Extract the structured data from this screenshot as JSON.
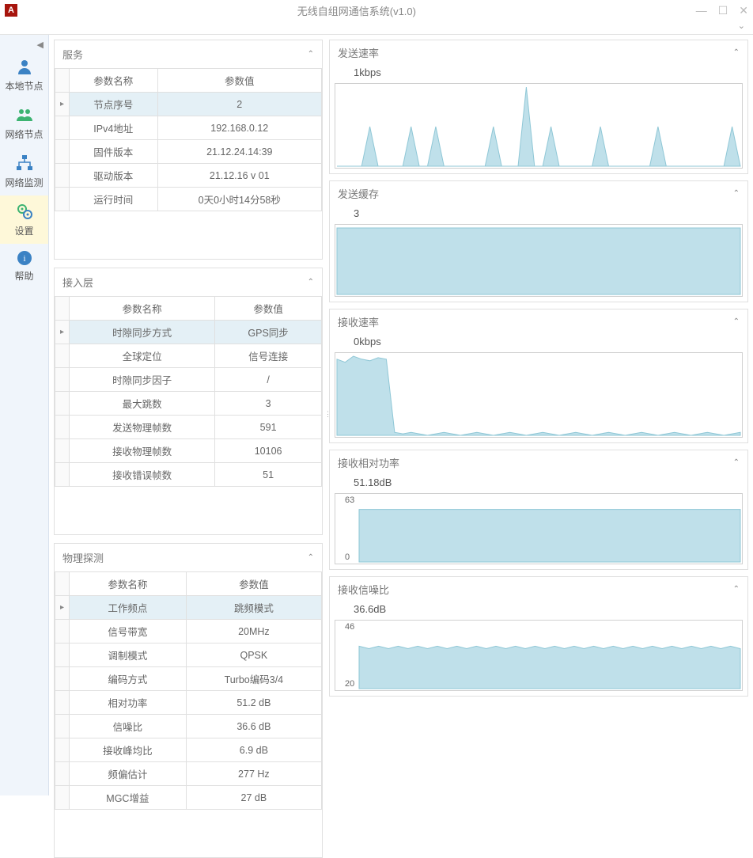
{
  "window": {
    "title": "无线自组网通信系统(v1.0)"
  },
  "sidebar": {
    "items": [
      {
        "label": "本地节点"
      },
      {
        "label": "网络节点"
      },
      {
        "label": "网络监测"
      },
      {
        "label": "设置"
      },
      {
        "label": "帮助"
      }
    ]
  },
  "panels": {
    "service": {
      "title": "服务",
      "headers": {
        "name": "参数名称",
        "value": "参数值"
      },
      "rows": [
        {
          "name": "节点序号",
          "value": "2",
          "hl": true
        },
        {
          "name": "IPv4地址",
          "value": "192.168.0.12"
        },
        {
          "name": "固件版本",
          "value": "21.12.24.14:39"
        },
        {
          "name": "驱动版本",
          "value": "21.12.16 v 01"
        },
        {
          "name": "运行时间",
          "value": "0天0小时14分58秒"
        }
      ]
    },
    "access": {
      "title": "接入层",
      "headers": {
        "name": "参数名称",
        "value": "参数值"
      },
      "rows": [
        {
          "name": "时隙同步方式",
          "value": "GPS同步",
          "hl": true
        },
        {
          "name": "全球定位",
          "value": "信号连接"
        },
        {
          "name": "时隙同步因子",
          "value": "/"
        },
        {
          "name": "最大跳数",
          "value": "3"
        },
        {
          "name": "发送物理帧数",
          "value": "591"
        },
        {
          "name": "接收物理帧数",
          "value": "10106"
        },
        {
          "name": "接收错误帧数",
          "value": "51"
        }
      ]
    },
    "phy": {
      "title": "物理探测",
      "headers": {
        "name": "参数名称",
        "value": "参数值"
      },
      "rows": [
        {
          "name": "工作频点",
          "value": "跳频模式",
          "hl": true
        },
        {
          "name": "信号带宽",
          "value": "20MHz"
        },
        {
          "name": "调制模式",
          "value": "QPSK"
        },
        {
          "name": "编码方式",
          "value": "Turbo编码3/4"
        },
        {
          "name": "相对功率",
          "value": "51.2 dB"
        },
        {
          "name": "信噪比",
          "value": "36.6 dB"
        },
        {
          "name": "接收峰均比",
          "value": "6.9 dB"
        },
        {
          "name": "频偏估计",
          "value": "277 Hz"
        },
        {
          "name": "MGC增益",
          "value": "27 dB"
        }
      ]
    }
  },
  "charts": {
    "tx_rate": {
      "title": "发送速率",
      "reading": "1kbps"
    },
    "tx_buf": {
      "title": "发送缓存",
      "reading": "3"
    },
    "rx_rate": {
      "title": "接收速率",
      "reading": "0kbps"
    },
    "rx_power": {
      "title": "接收相对功率",
      "reading": "51.18dB",
      "ymax": "63",
      "ymin": "0"
    },
    "rx_snr": {
      "title": "接收信噪比",
      "reading": "36.6dB",
      "ymax": "46",
      "ymin": "20"
    }
  },
  "chart_data": [
    {
      "type": "area",
      "title": "发送速率",
      "ylabel": "kbps",
      "values": [
        0,
        0,
        0,
        0,
        1,
        0,
        0,
        0,
        0,
        1,
        0,
        0,
        1,
        0,
        0,
        0,
        0,
        0,
        0,
        1,
        0,
        0,
        0,
        2,
        0,
        0,
        1,
        0,
        0,
        0,
        0,
        0,
        1,
        0,
        0,
        0,
        0,
        0,
        0,
        1,
        0,
        0,
        0,
        0,
        0,
        0,
        0,
        0,
        1,
        0
      ]
    },
    {
      "type": "area",
      "title": "发送缓存",
      "values": [
        3,
        3,
        3,
        3,
        3,
        3,
        3,
        3,
        3,
        3,
        3,
        3,
        3,
        3,
        3,
        3,
        3,
        3,
        3,
        3,
        3,
        3,
        3,
        3,
        3,
        3,
        3,
        3,
        3,
        3,
        3,
        3,
        3,
        3,
        3,
        3,
        3,
        3,
        3,
        3
      ]
    },
    {
      "type": "area",
      "title": "接收速率",
      "ylabel": "kbps",
      "values": [
        50,
        48,
        52,
        50,
        49,
        51,
        50,
        2,
        1,
        2,
        1,
        0,
        1,
        2,
        1,
        0,
        1,
        2,
        1,
        0,
        1,
        2,
        1,
        0,
        1,
        2,
        1,
        0,
        1,
        2,
        1,
        0,
        1,
        2,
        1,
        0,
        1,
        2,
        1,
        0,
        1,
        2,
        1,
        0,
        1,
        2,
        1,
        0,
        1,
        2
      ]
    },
    {
      "type": "area",
      "title": "接收相对功率",
      "ylabel": "dB",
      "ylim": [
        0,
        63
      ],
      "values": [
        51,
        51,
        51,
        51,
        51,
        51,
        51,
        51,
        51,
        51,
        51,
        51,
        51,
        51,
        51,
        51,
        51,
        51,
        51,
        51,
        51,
        51,
        51,
        51,
        51,
        51,
        51,
        51,
        51,
        51,
        51,
        51,
        51,
        51,
        51,
        51,
        51,
        51,
        51,
        51
      ]
    },
    {
      "type": "area",
      "title": "接收信噪比",
      "ylabel": "dB",
      "ylim": [
        20,
        46
      ],
      "values": [
        37,
        36,
        37,
        36,
        37,
        36,
        37,
        36,
        37,
        36,
        37,
        36,
        37,
        36,
        37,
        36,
        37,
        36,
        37,
        36,
        37,
        36,
        37,
        36,
        37,
        36,
        37,
        36,
        37,
        36,
        37,
        36,
        37,
        36,
        37,
        36,
        37,
        36,
        37,
        36
      ]
    }
  ]
}
